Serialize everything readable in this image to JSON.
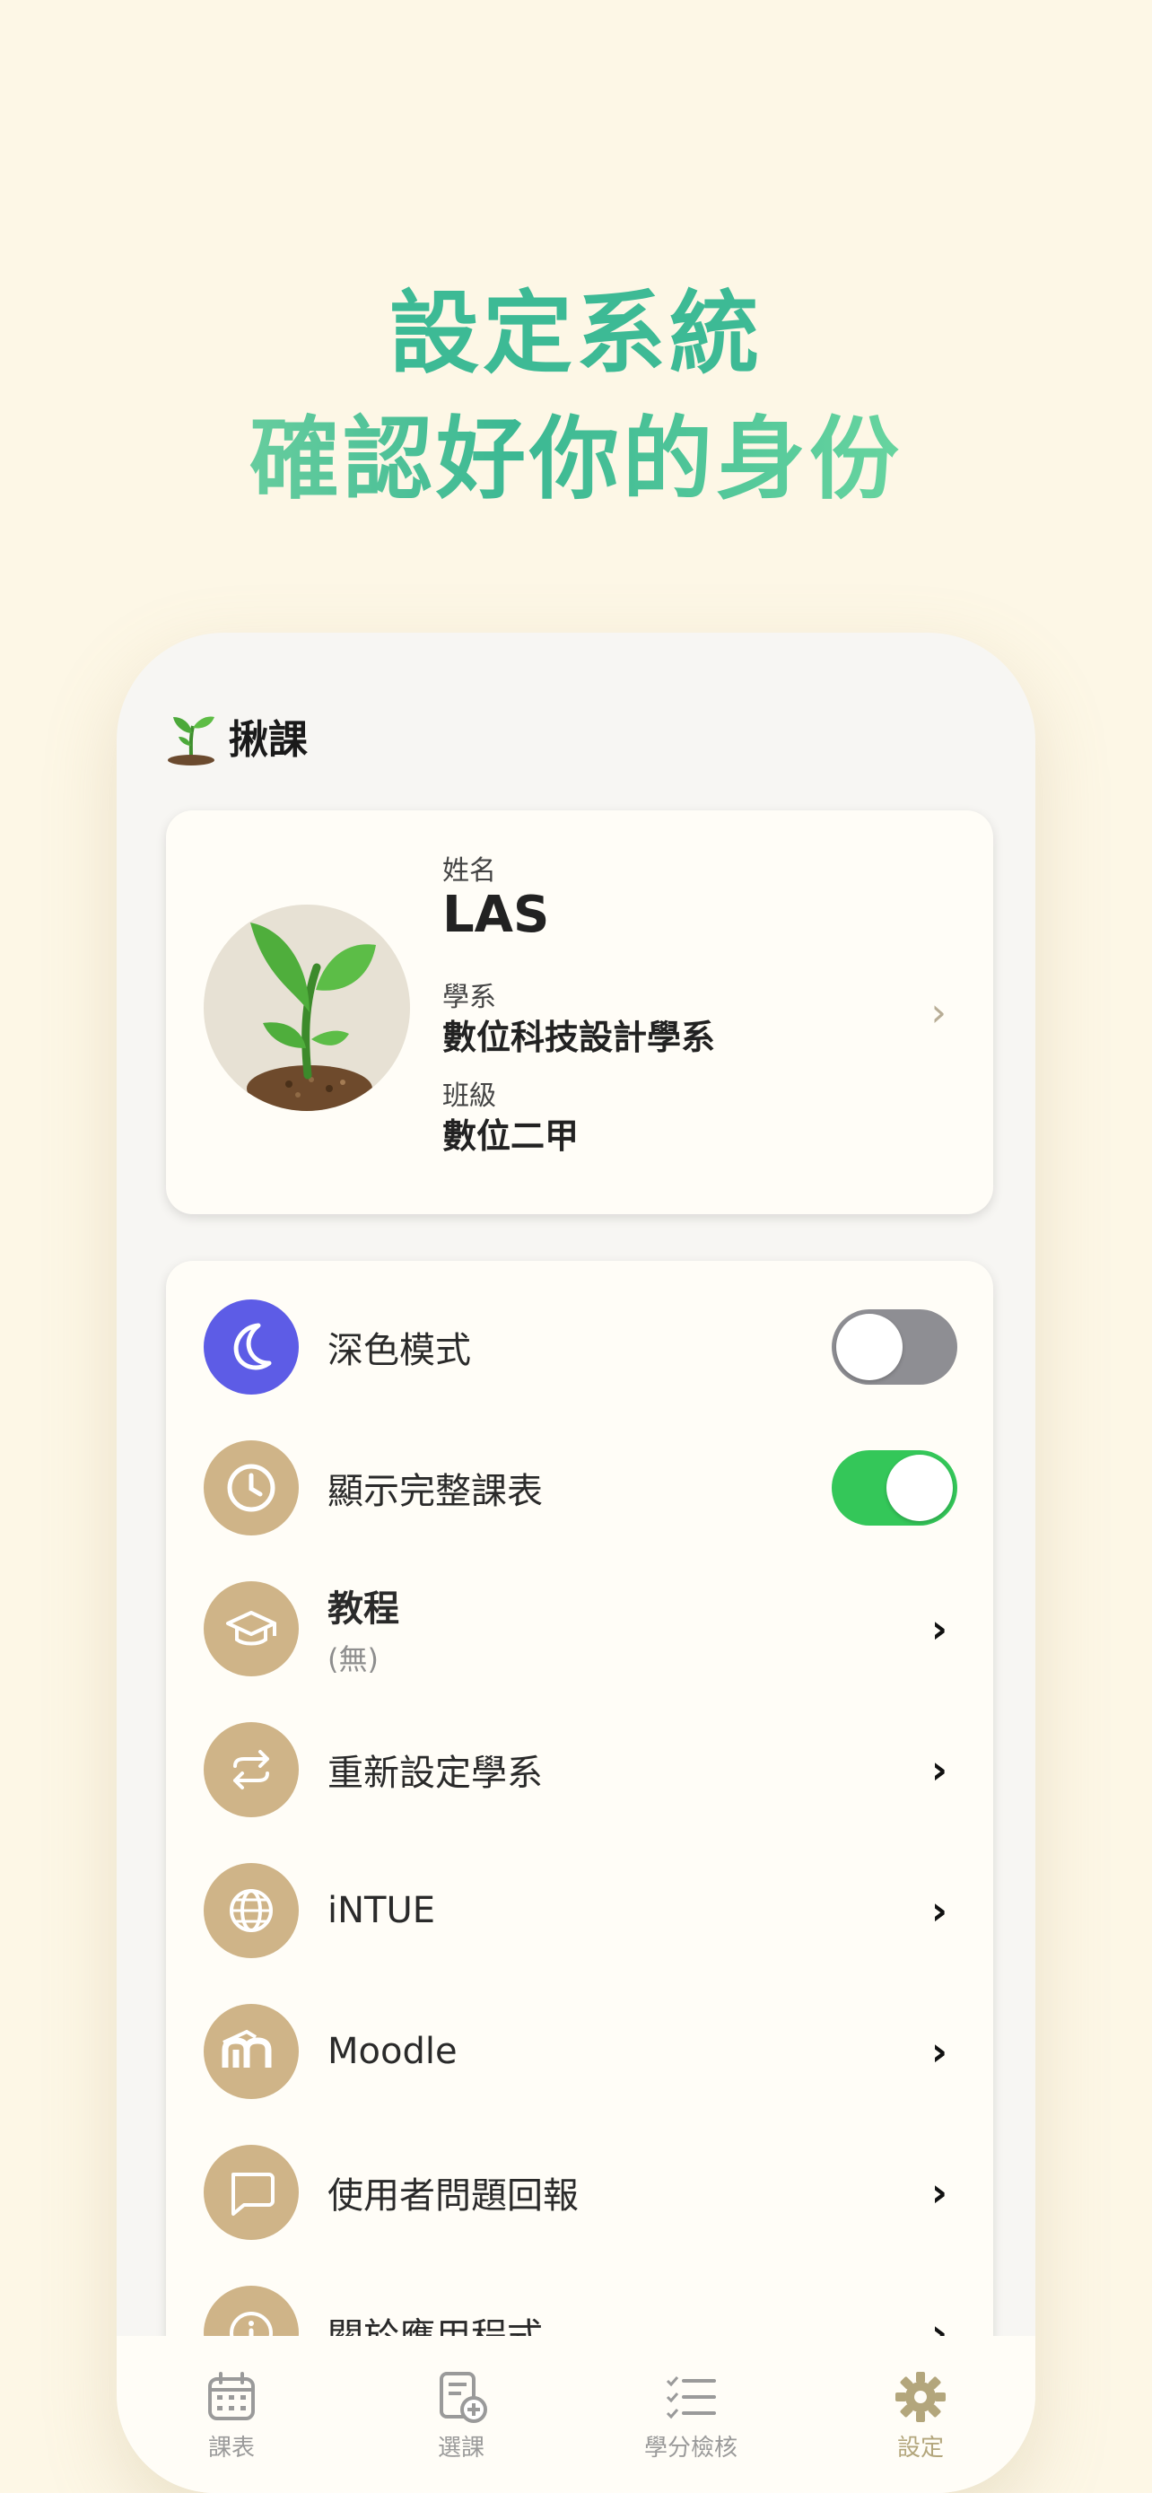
{
  "headline": {
    "line1": "設定系統",
    "line2": "確認好你的身份"
  },
  "app": {
    "title": "揪課"
  },
  "profile": {
    "name_label": "姓名",
    "name": "LAS",
    "department_label": "學系",
    "department": "數位科技設計學系",
    "class_label": "班級",
    "class": "數位二甲"
  },
  "settings": {
    "items": [
      {
        "label": "深色模式",
        "icon": "moon-icon",
        "control": "toggle",
        "value": false
      },
      {
        "label": "顯示完整課表",
        "icon": "clock-icon",
        "control": "toggle",
        "value": true
      },
      {
        "label": "教程",
        "sub": "(無)",
        "icon": "graduation-cap-icon",
        "control": "chevron"
      },
      {
        "label": "重新設定學系",
        "icon": "swap-arrows-icon",
        "control": "chevron"
      },
      {
        "label": "iNTUE",
        "icon": "globe-icon",
        "control": "chevron"
      },
      {
        "label": "Moodle",
        "icon": "moodle-icon",
        "control": "chevron"
      },
      {
        "label": "使用者問題回報",
        "icon": "chat-bubble-icon",
        "control": "chevron"
      },
      {
        "label": "關於應用程式",
        "icon": "info-icon",
        "control": "chevron"
      }
    ]
  },
  "tabbar": {
    "tabs": [
      {
        "label": "課表",
        "icon": "calendar-icon",
        "active": false
      },
      {
        "label": "選課",
        "icon": "add-course-icon",
        "active": false
      },
      {
        "label": "學分檢核",
        "icon": "checklist-icon",
        "active": false
      },
      {
        "label": "設定",
        "icon": "gear-icon",
        "active": true
      }
    ]
  },
  "colors": {
    "background": "#fdf7e6",
    "headline_green": "#3dba95",
    "icon_tan": "#cfb488",
    "dark_mode_icon": "#5d5ce6",
    "toggle_on": "#34c759",
    "toggle_off": "#8e8e93",
    "active_tab": "#b3a67c"
  }
}
